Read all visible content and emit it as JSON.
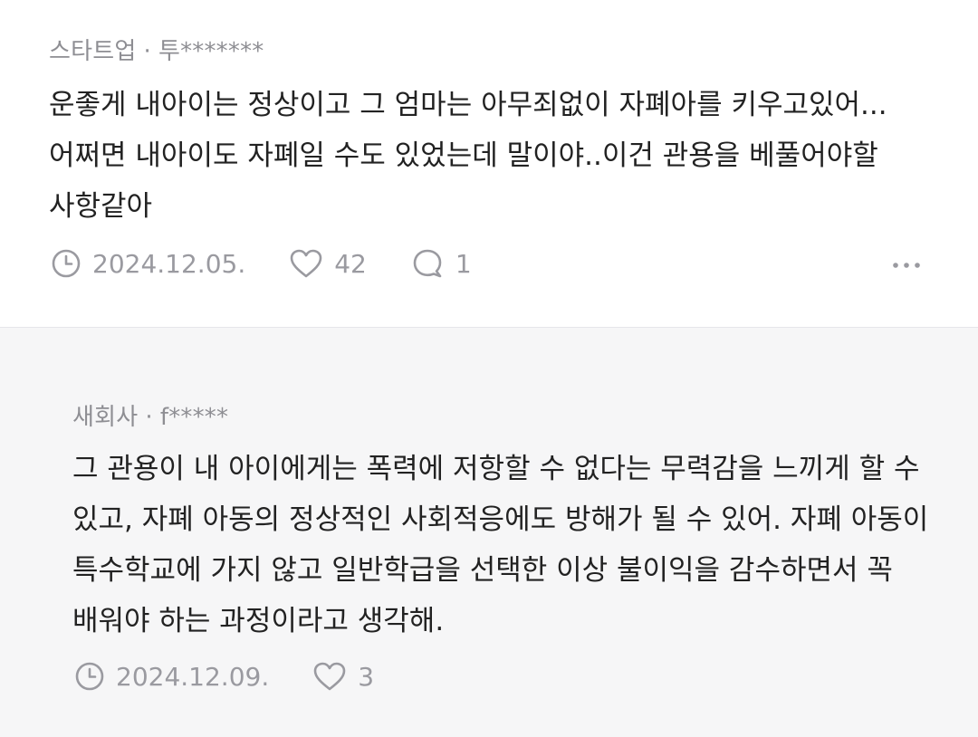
{
  "comment": {
    "category": "스타트업",
    "separator": "·",
    "author": "투*******",
    "text": "운좋게 내아이는 정상이고 그 엄마는 아무죄없이 자폐아를 키우고있어...어쩌면 내아이도 자폐일 수도 있었는데 말이야..이건 관용을 베풀어야할 사항같아",
    "date": "2024.12.05.",
    "likes": "42",
    "replies": "1",
    "icons": {
      "date": "clock-icon",
      "likes": "heart-icon",
      "replies": "speech-bubble-icon",
      "more": "more-dots-icon"
    }
  },
  "reply": {
    "category": "새회사",
    "separator": "·",
    "author": "f*****",
    "text": "그 관용이 내 아이에게는 폭력에 저항할 수 없다는 무력감을 느끼게 할 수 있고, 자폐 아동의 정상적인 사회적응에도 방해가 될 수 있어. 자폐 아동이 특수학교에 가지 않고 일반학급을 선택한 이상 불이익을 감수하면서 꼭 배워야 하는 과정이라고 생각해.",
    "date": "2024.12.09.",
    "likes": "3",
    "icons": {
      "date": "clock-icon",
      "likes": "heart-icon"
    }
  },
  "colors": {
    "text": "#222222",
    "meta": "#8e8e93",
    "icon": "#9a9aa0",
    "reply_background": "#f6f6f7"
  }
}
